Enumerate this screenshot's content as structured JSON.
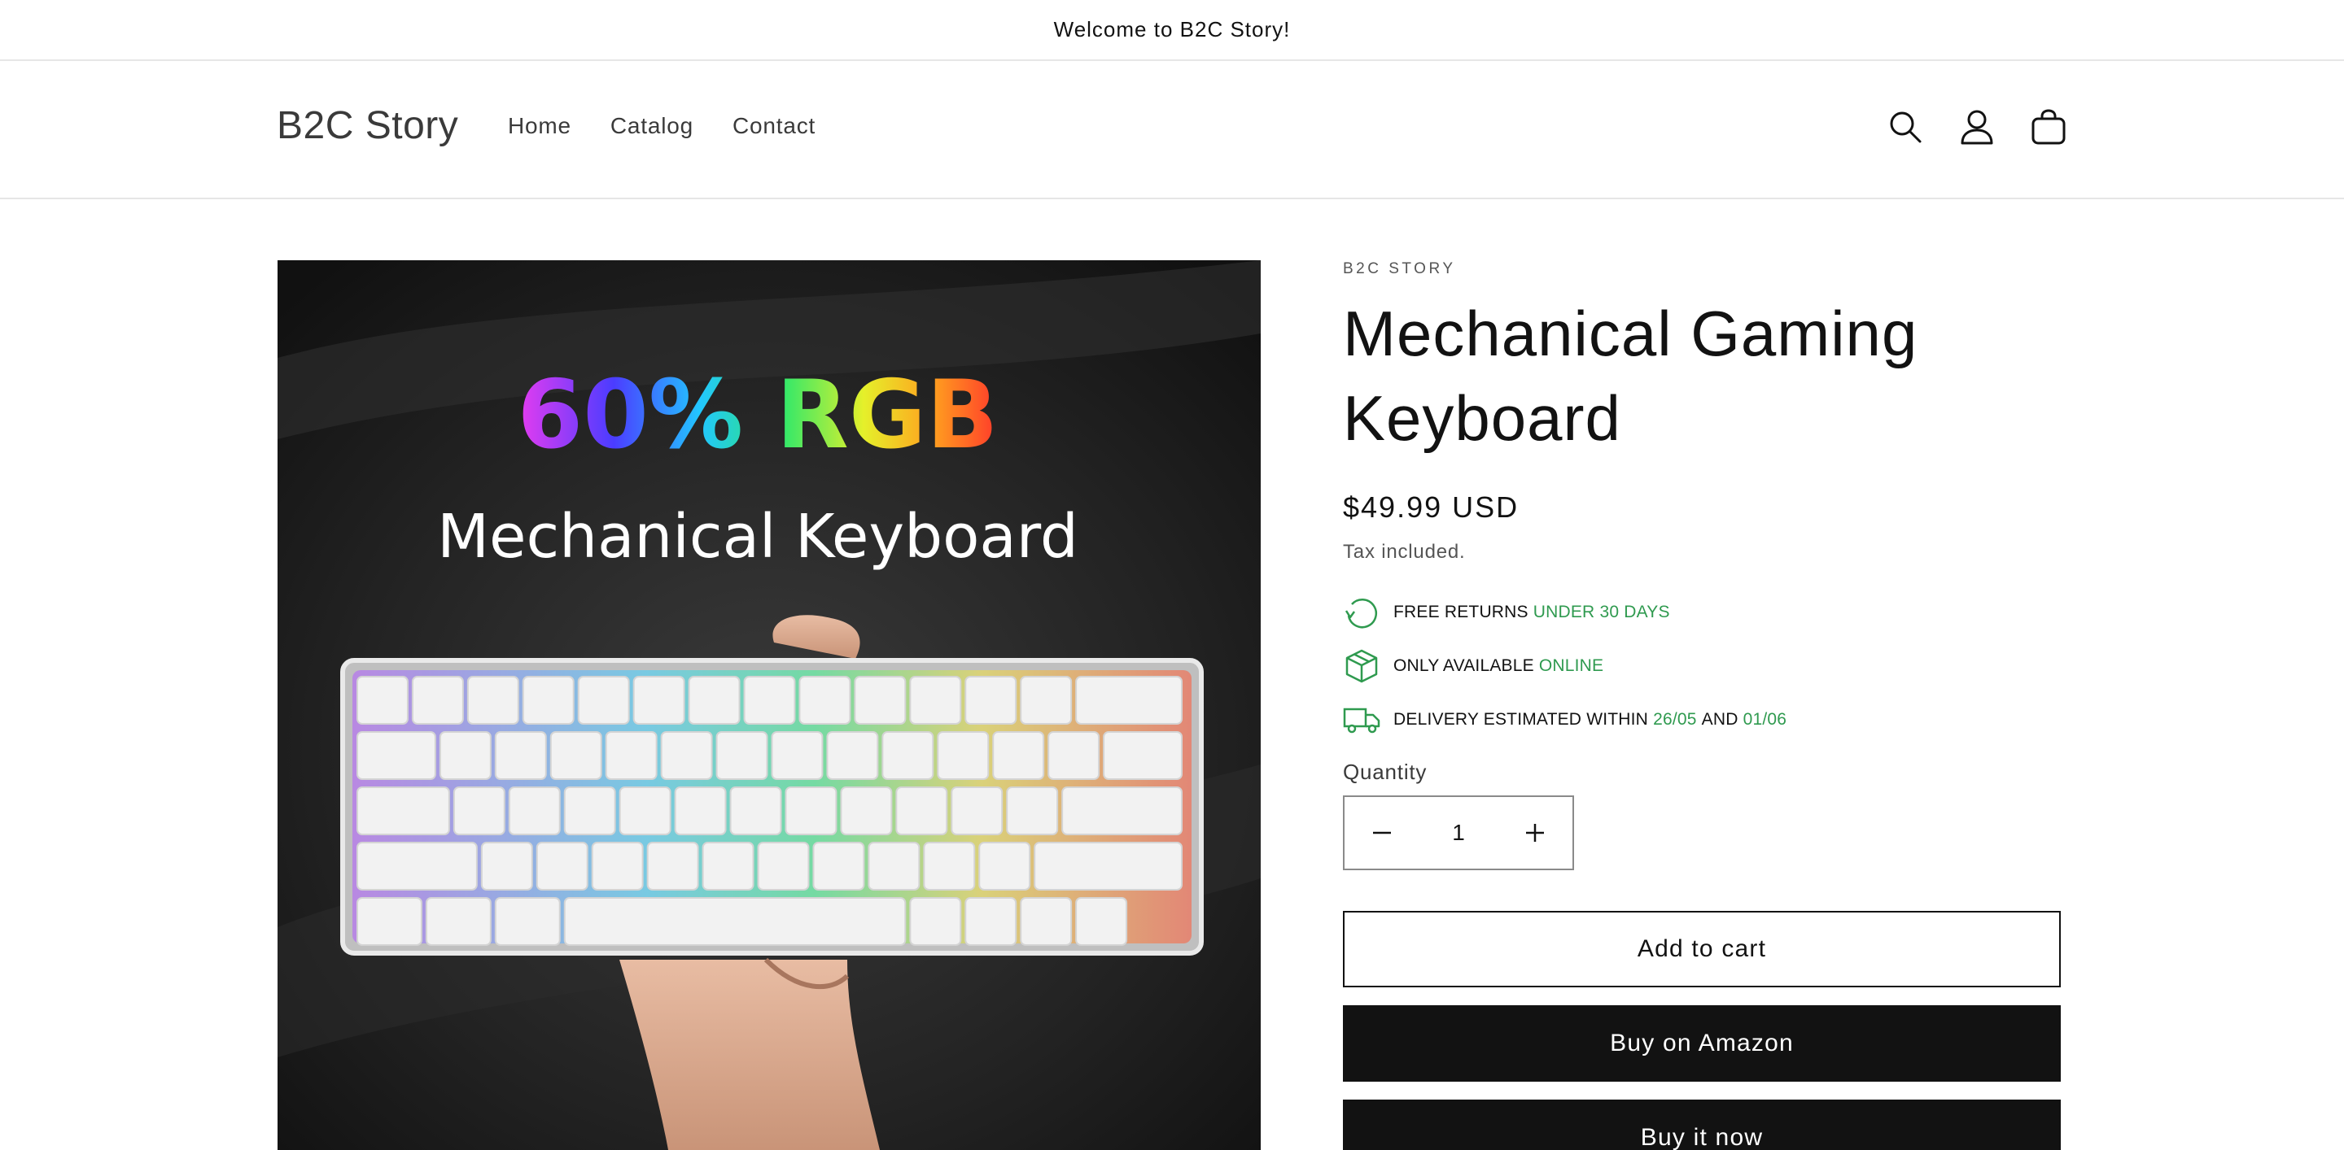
{
  "announcement": {
    "text": "Welcome to B2C Story!"
  },
  "header": {
    "logo": "B2C Story",
    "nav": [
      {
        "label": "Home"
      },
      {
        "label": "Catalog"
      },
      {
        "label": "Contact"
      }
    ],
    "icons": [
      "search-icon",
      "account-icon",
      "cart-icon"
    ]
  },
  "media": {
    "headline_top": "60% RGB",
    "headline_bottom": "Mechanical Keyboard"
  },
  "product": {
    "vendor": "B2C STORY",
    "title": "Mechanical Gaming Keyboard",
    "price": "$49.99 USD",
    "tax_note": "Tax included.",
    "perks": [
      {
        "icon": "returns-icon",
        "text": "FREE RETURNS",
        "highlight": "UNDER 30 DAYS"
      },
      {
        "icon": "box-icon",
        "text": "ONLY AVAILABLE",
        "highlight": "ONLINE"
      },
      {
        "icon": "truck-icon",
        "text": "DELIVERY ESTIMATED WITHIN",
        "highlight": "26/05",
        "middle": "AND",
        "highlight2": "01/06"
      }
    ],
    "quantity_label": "Quantity",
    "quantity_value": "1",
    "buttons": {
      "add_to_cart": "Add to cart",
      "buy_amazon": "Buy on Amazon",
      "buy_now": "Buy it now"
    }
  },
  "colors": {
    "accent_green": "#2f9a4f",
    "dark_button": "#121212",
    "text": "#121212"
  }
}
